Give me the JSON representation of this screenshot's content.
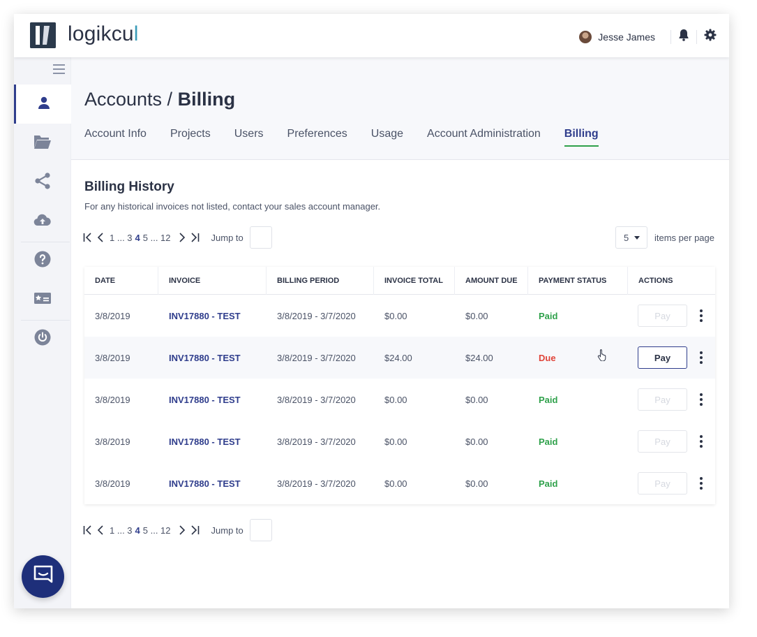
{
  "app": {
    "logo_text_main": "logikcu",
    "logo_text_accent": "l",
    "logo_text_tail": " "
  },
  "header": {
    "user_name": "Jesse James",
    "icons": [
      "avatar",
      "bell-icon",
      "gear-icon"
    ]
  },
  "sidebar": {
    "items": [
      {
        "icon": "user-icon",
        "active": true
      },
      {
        "icon": "folder-icon",
        "active": false
      },
      {
        "icon": "share-icon",
        "active": false
      },
      {
        "icon": "cloud-upload-icon",
        "active": false
      },
      {
        "icon": "help-icon",
        "active": false
      },
      {
        "icon": "id-card-icon",
        "active": false
      },
      {
        "icon": "power-icon",
        "active": false
      }
    ],
    "chat_icon": "chat-icon"
  },
  "page": {
    "title_prefix": "Accounts / ",
    "title_main": "Billing"
  },
  "tabs": [
    {
      "label": "Account Info"
    },
    {
      "label": "Projects"
    },
    {
      "label": "Users"
    },
    {
      "label": "Preferences"
    },
    {
      "label": "Usage"
    },
    {
      "label": "Account Administration"
    },
    {
      "label": "Billing",
      "active": true
    }
  ],
  "billing": {
    "title": "Billing History",
    "subtitle": "For any historical invoices not listed, contact your sales account manager."
  },
  "pagination": {
    "pages_before": "1 ... 3",
    "current": "4",
    "pages_after": "5 ... 12",
    "jump_label": "Jump to",
    "per_page_value": "5",
    "per_page_label": "items per page"
  },
  "table": {
    "headers": [
      "Date",
      "Invoice",
      "Billing Period",
      "Invoice Total",
      "Amount Due",
      "Payment Status",
      "Actions"
    ],
    "pay_label": "Pay",
    "rows": [
      {
        "date": "3/8/2019",
        "invoice": "INV17880 - TEST",
        "period": "3/8/2019 - 3/7/2020",
        "total": "$0.00",
        "due": "$0.00",
        "status": "Paid"
      },
      {
        "date": "3/8/2019",
        "invoice": "INV17880 - TEST",
        "period": "3/8/2019 - 3/7/2020",
        "total": "$24.00",
        "due": "$24.00",
        "status": "Due"
      },
      {
        "date": "3/8/2019",
        "invoice": "INV17880 - TEST",
        "period": "3/8/2019 - 3/7/2020",
        "total": "$0.00",
        "due": "$0.00",
        "status": "Paid"
      },
      {
        "date": "3/8/2019",
        "invoice": "INV17880 - TEST",
        "period": "3/8/2019 - 3/7/2020",
        "total": "$0.00",
        "due": "$0.00",
        "status": "Paid"
      },
      {
        "date": "3/8/2019",
        "invoice": "INV17880 - TEST",
        "period": "3/8/2019 - 3/7/2020",
        "total": "$0.00",
        "due": "$0.00",
        "status": "Paid"
      }
    ]
  },
  "colors": {
    "brand_navy": "#2f3d8c",
    "paid_green": "#2fa14b",
    "due_red": "#e0453a",
    "chat_blue": "#1e2f7a"
  }
}
